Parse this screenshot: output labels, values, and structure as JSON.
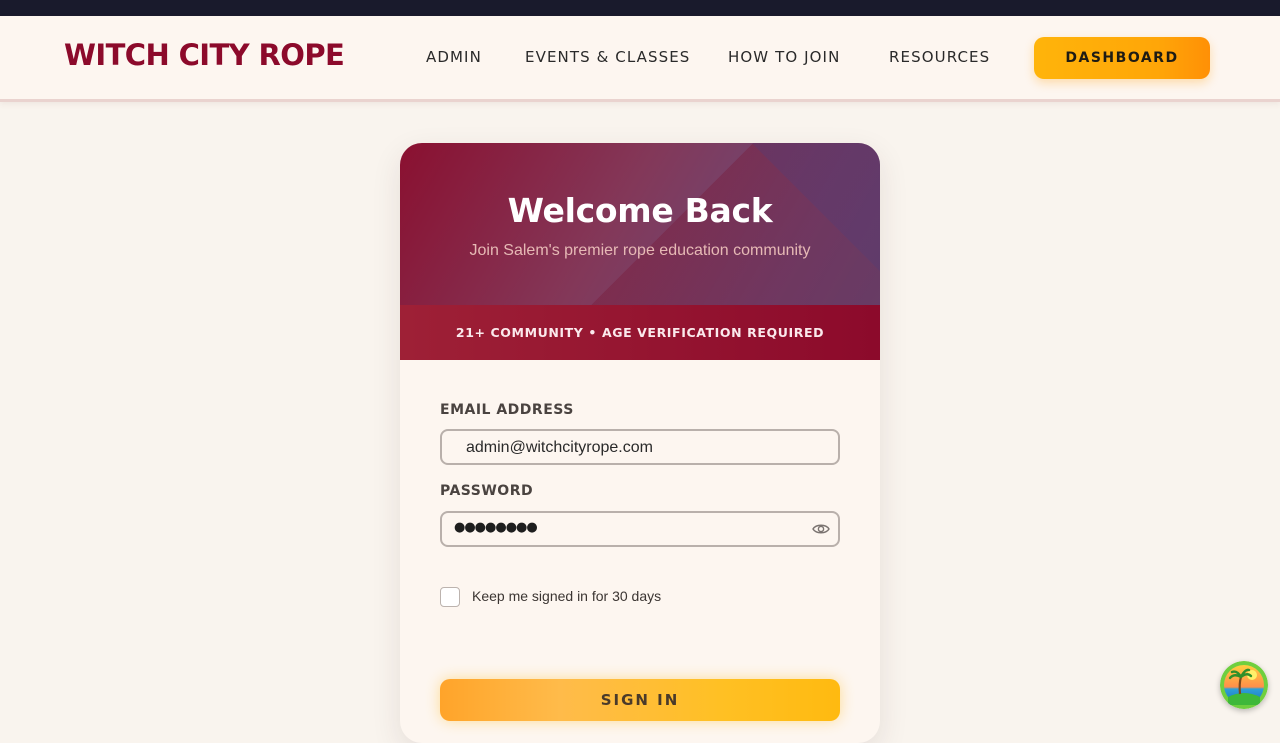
{
  "header": {
    "brand": "WITCH CITY ROPE",
    "nav": [
      {
        "label": "ADMIN"
      },
      {
        "label": "EVENTS & CLASSES"
      },
      {
        "label": "HOW TO JOIN"
      },
      {
        "label": "RESOURCES"
      }
    ],
    "dashboard_label": "DASHBOARD"
  },
  "login": {
    "title": "Welcome Back",
    "subtitle": "Join Salem's premier rope education community",
    "age_notice": "21+ COMMUNITY • AGE VERIFICATION REQUIRED",
    "email_label": "EMAIL ADDRESS",
    "email_value": "admin@witchcityrope.com",
    "password_label": "PASSWORD",
    "password_mask": "●●●●●●●●",
    "remember_label": "Keep me signed in for 30 days",
    "remember_checked": false,
    "submit_label": "SIGN IN"
  },
  "icons": {
    "password_toggle": "eye-icon",
    "floating_widget": "beach-palm-icon"
  },
  "colors": {
    "brand": "#8c0a2b",
    "accent": "#ffa608",
    "top_strip": "#191a2c",
    "background": "#f9f4ee"
  }
}
